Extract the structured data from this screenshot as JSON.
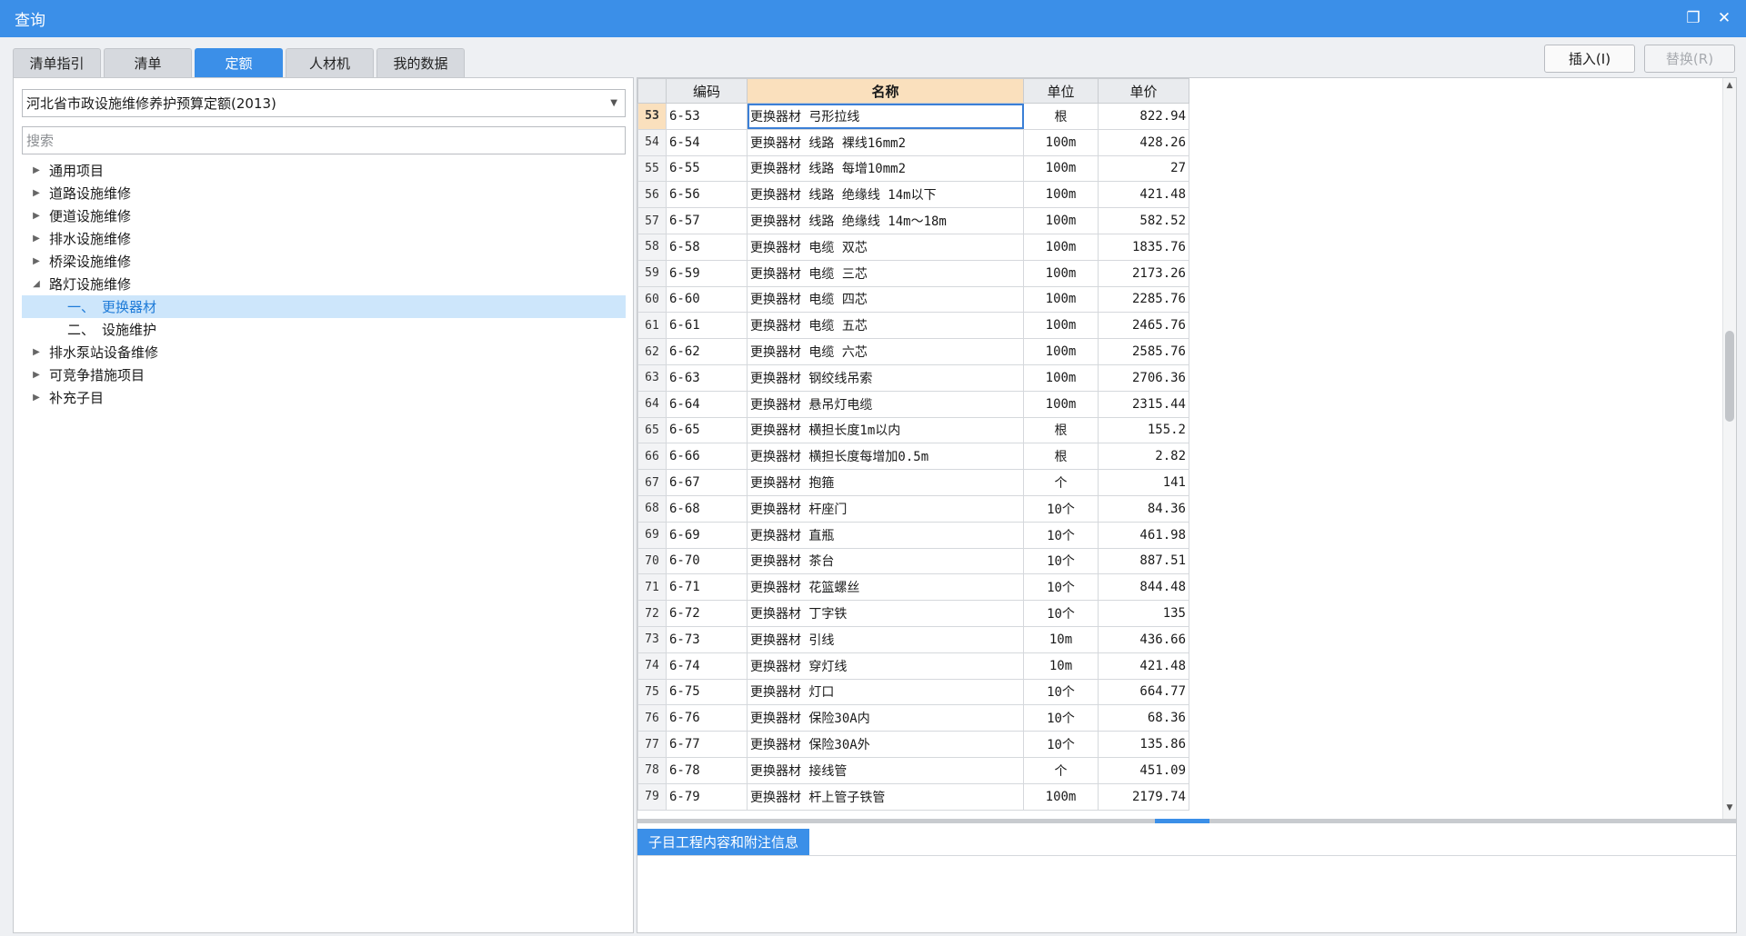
{
  "window": {
    "title": "查询"
  },
  "tabs": [
    {
      "label": "清单指引",
      "active": false
    },
    {
      "label": "清单",
      "active": false
    },
    {
      "label": "定额",
      "active": true
    },
    {
      "label": "人材机",
      "active": false
    },
    {
      "label": "我的数据",
      "active": false
    }
  ],
  "actions": {
    "insert": "插入(I)",
    "replace": "替换(R)"
  },
  "library": {
    "selected": "河北省市政设施维修养护预算定额(2013)"
  },
  "search": {
    "placeholder": "搜索",
    "value": ""
  },
  "tree": [
    {
      "label": "通用项目",
      "expanded": false
    },
    {
      "label": "道路设施维修",
      "expanded": false
    },
    {
      "label": "便道设施维修",
      "expanded": false
    },
    {
      "label": "排水设施维修",
      "expanded": false
    },
    {
      "label": "桥梁设施维修",
      "expanded": false
    },
    {
      "label": "路灯设施维修",
      "expanded": true,
      "children": [
        {
          "num": "一、",
          "label": "更换器材",
          "selected": true
        },
        {
          "num": "二、",
          "label": "设施维护",
          "selected": false
        }
      ]
    },
    {
      "label": "排水泵站设备维修",
      "expanded": false
    },
    {
      "label": "可竞争措施项目",
      "expanded": false
    },
    {
      "label": "补充子目",
      "expanded": false
    }
  ],
  "grid": {
    "columns": {
      "code": "编码",
      "name": "名称",
      "unit": "单位",
      "price": "单价"
    },
    "current_row": "53",
    "rows": [
      {
        "n": "53",
        "code": "6-53",
        "name": "更换器材 弓形拉线",
        "unit": "根",
        "price": "822.94"
      },
      {
        "n": "54",
        "code": "6-54",
        "name": "更换器材 线路 裸线16mm2",
        "unit": "100m",
        "price": "428.26"
      },
      {
        "n": "55",
        "code": "6-55",
        "name": "更换器材 线路 每增10mm2",
        "unit": "100m",
        "price": "27"
      },
      {
        "n": "56",
        "code": "6-56",
        "name": "更换器材 线路 绝缘线 14m以下",
        "unit": "100m",
        "price": "421.48"
      },
      {
        "n": "57",
        "code": "6-57",
        "name": "更换器材 线路 绝缘线 14m～18m",
        "unit": "100m",
        "price": "582.52"
      },
      {
        "n": "58",
        "code": "6-58",
        "name": "更换器材 电缆 双芯",
        "unit": "100m",
        "price": "1835.76"
      },
      {
        "n": "59",
        "code": "6-59",
        "name": "更换器材 电缆 三芯",
        "unit": "100m",
        "price": "2173.26"
      },
      {
        "n": "60",
        "code": "6-60",
        "name": "更换器材 电缆 四芯",
        "unit": "100m",
        "price": "2285.76"
      },
      {
        "n": "61",
        "code": "6-61",
        "name": "更换器材 电缆 五芯",
        "unit": "100m",
        "price": "2465.76"
      },
      {
        "n": "62",
        "code": "6-62",
        "name": "更换器材 电缆 六芯",
        "unit": "100m",
        "price": "2585.76"
      },
      {
        "n": "63",
        "code": "6-63",
        "name": "更换器材 钢绞线吊索",
        "unit": "100m",
        "price": "2706.36"
      },
      {
        "n": "64",
        "code": "6-64",
        "name": "更换器材 悬吊灯电缆",
        "unit": "100m",
        "price": "2315.44"
      },
      {
        "n": "65",
        "code": "6-65",
        "name": "更换器材 横担长度1m以内",
        "unit": "根",
        "price": "155.2"
      },
      {
        "n": "66",
        "code": "6-66",
        "name": "更换器材 横担长度每增加0.5m",
        "unit": "根",
        "price": "2.82"
      },
      {
        "n": "67",
        "code": "6-67",
        "name": "更换器材 抱箍",
        "unit": "个",
        "price": "141"
      },
      {
        "n": "68",
        "code": "6-68",
        "name": "更换器材 杆座门",
        "unit": "10个",
        "price": "84.36"
      },
      {
        "n": "69",
        "code": "6-69",
        "name": "更换器材 直瓶",
        "unit": "10个",
        "price": "461.98"
      },
      {
        "n": "70",
        "code": "6-70",
        "name": "更换器材 茶台",
        "unit": "10个",
        "price": "887.51"
      },
      {
        "n": "71",
        "code": "6-71",
        "name": "更换器材 花篮螺丝",
        "unit": "10个",
        "price": "844.48"
      },
      {
        "n": "72",
        "code": "6-72",
        "name": "更换器材 丁字铁",
        "unit": "10个",
        "price": "135"
      },
      {
        "n": "73",
        "code": "6-73",
        "name": "更换器材 引线",
        "unit": "10m",
        "price": "436.66"
      },
      {
        "n": "74",
        "code": "6-74",
        "name": "更换器材 穿灯线",
        "unit": "10m",
        "price": "421.48"
      },
      {
        "n": "75",
        "code": "6-75",
        "name": "更换器材 灯口",
        "unit": "10个",
        "price": "664.77"
      },
      {
        "n": "76",
        "code": "6-76",
        "name": "更换器材 保险30A内",
        "unit": "10个",
        "price": "68.36"
      },
      {
        "n": "77",
        "code": "6-77",
        "name": "更换器材 保险30A外",
        "unit": "10个",
        "price": "135.86"
      },
      {
        "n": "78",
        "code": "6-78",
        "name": "更换器材 接线管",
        "unit": "个",
        "price": "451.09"
      },
      {
        "n": "79",
        "code": "6-79",
        "name": "更换器材 杆上管子铁管",
        "unit": "100m",
        "price": "2179.74"
      }
    ]
  },
  "bottom": {
    "tab_label": "子目工程内容和附注信息"
  },
  "colors": {
    "accent": "#3b8fe8",
    "header_highlight": "#fae0bd",
    "selected_tree": "#cde6fb"
  }
}
